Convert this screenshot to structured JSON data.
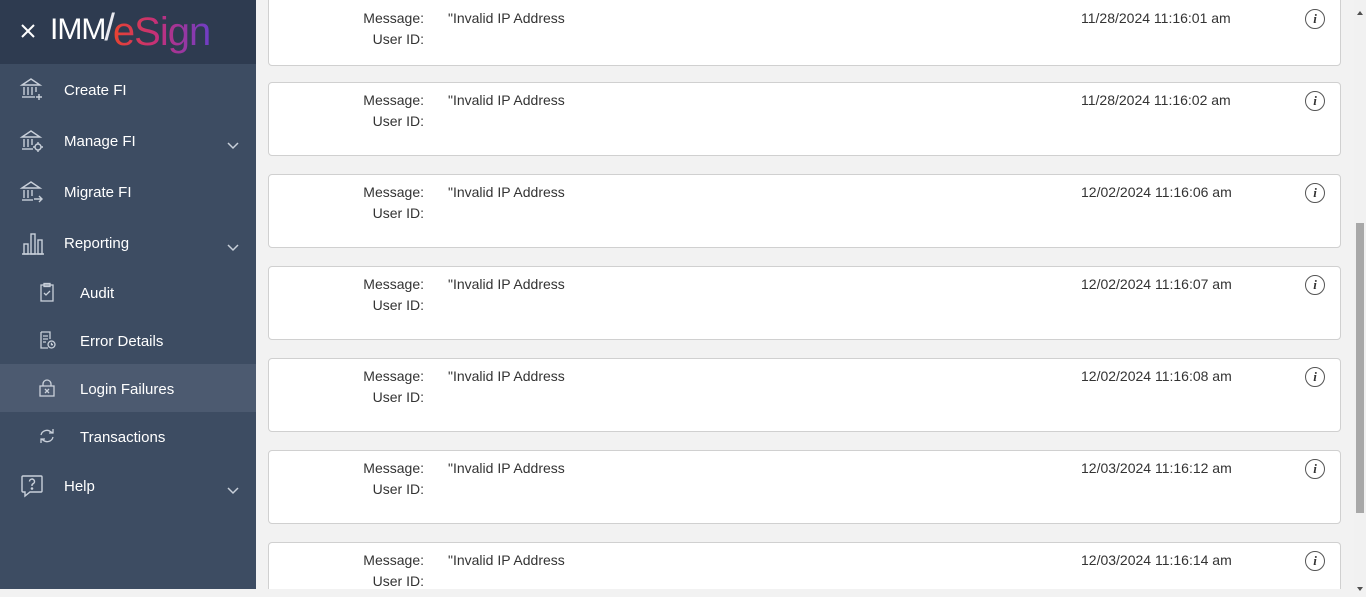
{
  "app": {
    "logo_text": "IMM eSign"
  },
  "sidebar": {
    "items": [
      {
        "label": "Create FI",
        "icon": "bank-add-icon"
      },
      {
        "label": "Manage FI",
        "icon": "bank-settings-icon"
      },
      {
        "label": "Migrate FI",
        "icon": "bank-migrate-icon"
      },
      {
        "label": "Reporting",
        "icon": "bar-chart-icon"
      },
      {
        "label": "Audit",
        "icon": "clipboard-check-icon"
      },
      {
        "label": "Error Details",
        "icon": "document-clock-icon"
      },
      {
        "label": "Login Failures",
        "icon": "lock-x-icon"
      },
      {
        "label": "Transactions",
        "icon": "sync-icon"
      },
      {
        "label": "Help",
        "icon": "question-bubble-icon"
      }
    ]
  },
  "records": [
    {
      "message_label": "Message:",
      "user_label": "User ID:",
      "message": "\"Invalid IP Address",
      "user_id": "",
      "timestamp": "11/28/2024 11:16:01 am"
    },
    {
      "message_label": "Message:",
      "user_label": "User ID:",
      "message": "\"Invalid IP Address",
      "user_id": "",
      "timestamp": "11/28/2024 11:16:02 am"
    },
    {
      "message_label": "Message:",
      "user_label": "User ID:",
      "message": "\"Invalid IP Address",
      "user_id": "",
      "timestamp": "12/02/2024 11:16:06 am"
    },
    {
      "message_label": "Message:",
      "user_label": "User ID:",
      "message": "\"Invalid IP Address",
      "user_id": "",
      "timestamp": "12/02/2024 11:16:07 am"
    },
    {
      "message_label": "Message:",
      "user_label": "User ID:",
      "message": "\"Invalid IP Address",
      "user_id": "",
      "timestamp": "12/02/2024 11:16:08 am"
    },
    {
      "message_label": "Message:",
      "user_label": "User ID:",
      "message": "\"Invalid IP Address",
      "user_id": "",
      "timestamp": "12/03/2024 11:16:12 am"
    },
    {
      "message_label": "Message:",
      "user_label": "User ID:",
      "message": "\"Invalid IP Address",
      "user_id": "",
      "timestamp": "12/03/2024 11:16:14 am"
    }
  ],
  "info_glyph": "i",
  "colors": {
    "sidebar_bg": "#3d4c62",
    "sidebar_header_bg": "#2e3b50",
    "active_item_bg": "#4c5a70",
    "content_bg": "#f2f2f2"
  }
}
